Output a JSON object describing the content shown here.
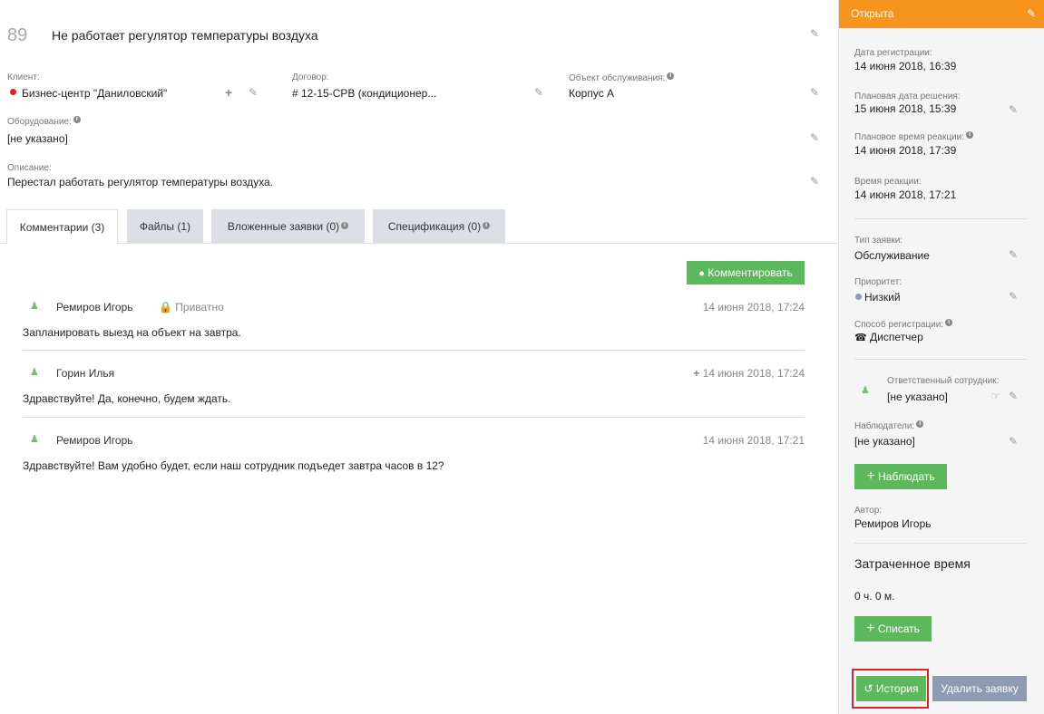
{
  "ticket": {
    "number": "89",
    "title": "Не работает регулятор температуры воздуха",
    "client_label": "Клиент:",
    "client_value": "Бизнес-центр \"Даниловский\"",
    "contract_label": "Договор:",
    "contract_value": "# 12-15-СРВ (кондиционер...",
    "object_label": "Объект обслуживания:",
    "object_value": "Корпус А",
    "equipment_label": "Оборудование:",
    "equipment_value": "[не указано]",
    "description_label": "Описание:",
    "description_value": "Перестал работать регулятор температуры воздуха."
  },
  "tabs": [
    {
      "label": "Комментарии (3)"
    },
    {
      "label": "Файлы (1)"
    },
    {
      "label": "Вложенные заявки (0)"
    },
    {
      "label": "Спецификация (0)"
    }
  ],
  "comment_button": "Комментировать",
  "comments": [
    {
      "author": "Ремиров Игорь",
      "private": "Приватно",
      "date": "14 июня 2018, 17:24",
      "text": "Запланировать выезд на объект на завтра."
    },
    {
      "author": "Горин Илья",
      "date": "14 июня 2018, 17:24",
      "text": "Здравствуйте! Да, конечно, будем ждать."
    },
    {
      "author": "Ремиров Игорь",
      "date": "14 июня 2018, 17:21",
      "text": "Здравствуйте! Вам удобно будет, если наш сотрудник подъедет завтра часов в 12?"
    }
  ],
  "sidebar": {
    "status": "Открыта",
    "reg_date_label": "Дата регистрации:",
    "reg_date_value": "14 июня 2018, 16:39",
    "planned_label": "Плановая дата решения:",
    "planned_value": "15 июня 2018, 15:39",
    "planned_reaction_label": "Плановое время реакции:",
    "planned_reaction_value": "14 июня 2018, 17:39",
    "reaction_label": "Время реакции:",
    "reaction_value": "14 июня 2018, 17:21",
    "type_label": "Тип заявки:",
    "type_value": "Обслуживание",
    "priority_label": "Приоритет:",
    "priority_value": "Низкий",
    "method_label": "Способ регистрации:",
    "method_value": "Диспетчер",
    "responsible_label": "Ответственный сотрудник:",
    "responsible_value": "[не указано]",
    "observers_label": "Наблюдатели:",
    "observers_value": "[не указано]",
    "observe_button": "Наблюдать",
    "author_label": "Автор:",
    "author_value": "Ремиров Игорь",
    "time_title": "Затраченное время",
    "time_value": "0 ч. 0 м.",
    "writeoff_button": "Списать",
    "history_button": "История",
    "delete_button": "Удалить заявку"
  },
  "colors": {
    "accent_orange": "#f7941d",
    "green": "#5cb85c",
    "gray_button": "#8e9bb0",
    "client_dot": "#e02020",
    "highlight": "#e0202c"
  }
}
